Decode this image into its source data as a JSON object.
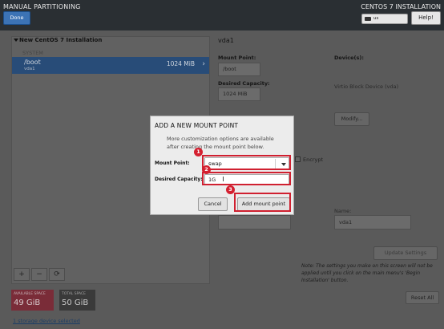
{
  "header": {
    "title": "MANUAL PARTITIONING",
    "done_label": "Done",
    "right_title": "CENTOS 7 INSTALLATION",
    "keyboard": "us",
    "help_label": "Help!"
  },
  "left": {
    "install_title": "New CentOS 7 Installation",
    "system_label": "SYSTEM",
    "partition": {
      "mount": "/boot",
      "device": "vda1",
      "size": "1024 MiB"
    },
    "tools": [
      "+",
      "−",
      "⟳"
    ],
    "available": {
      "label": "AVAILABLE SPACE",
      "value": "49 GiB"
    },
    "total": {
      "label": "TOTAL SPACE",
      "value": "50 GiB"
    },
    "storage_link": "1 storage device selected"
  },
  "right": {
    "section_title": "vda1",
    "mount_point_label": "Mount Point:",
    "mount_point_value": "/boot",
    "desired_capacity_label": "Desired Capacity:",
    "desired_capacity_value": "1024 MiB",
    "devices_label": "Device(s):",
    "device_value": "Virtio Block Device (vda)",
    "modify_label": "Modify...",
    "encrypt_label": "Encrypt",
    "name_label": "Name:",
    "name_value": "vda1",
    "update_label": "Update Settings",
    "note": "Note:  The settings you make on this screen will not be applied until you click on the main menu's 'Begin Installation' button.",
    "reset_label": "Reset All"
  },
  "dialog": {
    "title": "ADD A NEW MOUNT POINT",
    "info": "More customization options are available after creating the mount point below.",
    "mount_point_label": "Mount Point:",
    "mount_point_value": "swap",
    "capacity_label": "Desired Capacity:",
    "capacity_value": "1G",
    "cancel_label": "Cancel",
    "add_label": "Add mount point"
  },
  "annotations": [
    "1",
    "2",
    "3"
  ],
  "colors": {
    "accent": "#3c73b5",
    "selected_row": "#284c78",
    "annotation": "#d02030"
  }
}
